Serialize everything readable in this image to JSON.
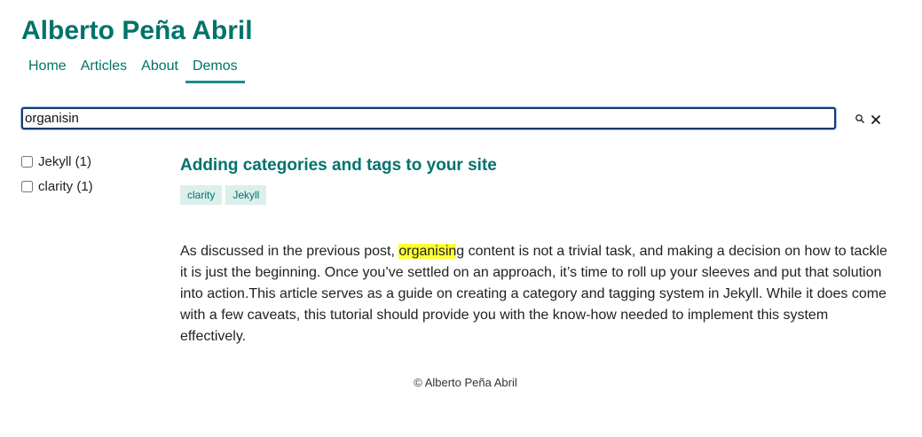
{
  "site": {
    "title": "Alberto Peña Abril"
  },
  "nav": {
    "items": [
      {
        "label": "Home"
      },
      {
        "label": "Articles"
      },
      {
        "label": "About"
      },
      {
        "label": "Demos"
      }
    ],
    "active": "Demos"
  },
  "search": {
    "value": "organisin",
    "search_icon": "search-icon",
    "clear_icon": "close-icon"
  },
  "filters": [
    {
      "label": "Jekyll (1)",
      "checked": false
    },
    {
      "label": "clarity (1)",
      "checked": false
    }
  ],
  "article": {
    "title": "Adding categories and tags to your site",
    "tags": [
      "clarity",
      "Jekyll"
    ],
    "excerpt_before": "As discussed in the previous post, ",
    "excerpt_highlight": "organisin",
    "excerpt_after": "g content is not a trivial task, and making a decision on how to tackle it is just the beginning. Once you’ve settled on an approach, it’s time to roll up your sleeves and put that solution into action.This article serves as a guide on creating a category and tagging system in Jekyll. While it does come with a few caveats, this tutorial should provide you with the know-how needed to implement this system effectively."
  },
  "footer": {
    "text": "© Alberto Peña Abril"
  },
  "colors": {
    "accent": "#00736b",
    "tag_bg": "#dcefec",
    "highlight": "#ffff33"
  }
}
